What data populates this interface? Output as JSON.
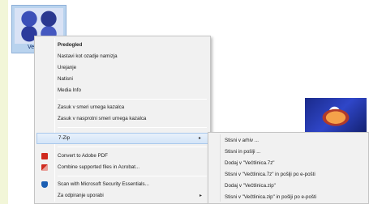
{
  "desktop": {
    "file_label": "Več..."
  },
  "context_menu": {
    "items": [
      {
        "label": "Predogled",
        "bold": true
      },
      {
        "label": "Nastavi kot ozadje namizja"
      },
      {
        "label": "Urejanje"
      },
      {
        "label": "Natisni"
      },
      {
        "label": "Media Info"
      },
      {
        "label": "Zasuk v smeri urnega kazalca"
      },
      {
        "label": "Zasuk v nasprotni smeri urnega kazalca"
      },
      {
        "label": "7-Zip",
        "submenu": true
      },
      {
        "label": "Convert to Adobe PDF",
        "icon": "pdf-icon"
      },
      {
        "label": "Combine supported files in Acrobat...",
        "icon": "acrobat-combine-icon"
      },
      {
        "label": "Scan with Microsoft Security Essentials...",
        "icon": "security-shield-icon"
      },
      {
        "label": "Za odpiranje uporabi",
        "submenu": true
      }
    ],
    "submenu_arrow": "▸"
  },
  "zip_submenu": {
    "items": [
      {
        "label": "Stisni v arhiv ..."
      },
      {
        "label": "Stisni in pošlji ..."
      },
      {
        "label": "Dodaj v \"Večtlinica.7z\""
      },
      {
        "label": "Stisni v \"Večtlinica.7z\" in pošlji po e-pošti"
      },
      {
        "label": "Dodaj v \"Večtlinica.zip\""
      },
      {
        "label": "Stisni v \"Večtlinica.zip\" in pošlji po e-pošti"
      }
    ]
  }
}
